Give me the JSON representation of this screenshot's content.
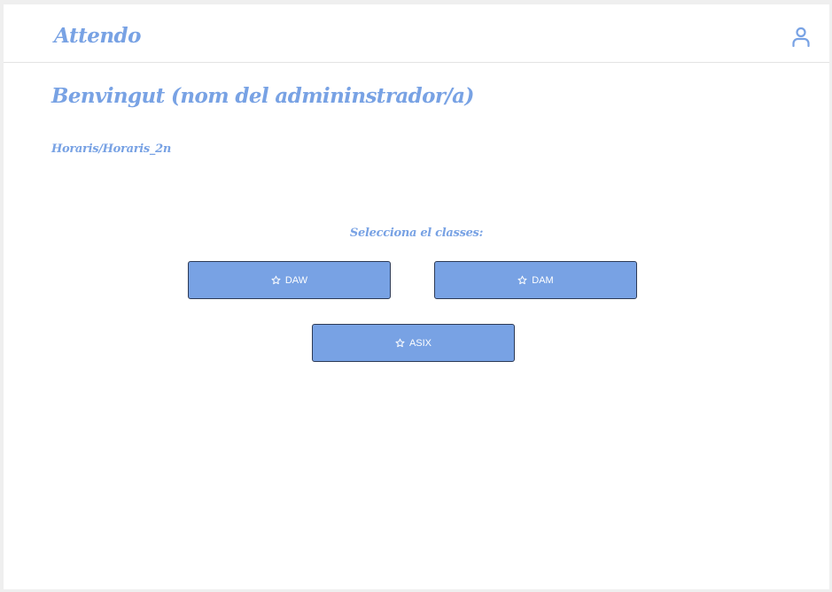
{
  "header": {
    "logo": "Attendo",
    "user_icon": "user-icon"
  },
  "main": {
    "welcome": "Benvingut (nom del admininstrador/a)",
    "breadcrumb": "Horaris/Horaris_2n",
    "prompt": "Selecciona el classes:",
    "classes": [
      {
        "label": "DAW",
        "icon": "star-icon"
      },
      {
        "label": "DAM",
        "icon": "star-icon"
      },
      {
        "label": "ASIX",
        "icon": "star-icon"
      }
    ]
  },
  "colors": {
    "accent": "#78a2e4",
    "button_border": "#2d3a55",
    "background": "#ffffff"
  }
}
